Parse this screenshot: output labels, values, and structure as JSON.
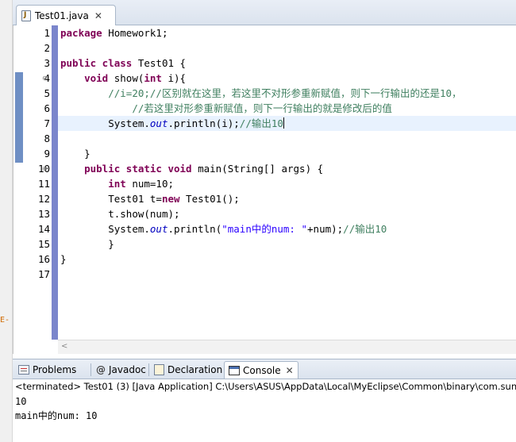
{
  "editor": {
    "tab": {
      "title": "Test01.java",
      "close": "✕",
      "icon": "java-file-icon"
    },
    "line_numbers": [
      "1",
      "2",
      "3",
      "4",
      "5",
      "6",
      "7",
      "8",
      "9",
      "10",
      "11",
      "12",
      "13",
      "14",
      "15",
      "16",
      "17"
    ],
    "lines": {
      "l1": {
        "kw": "package",
        "rest": " Homework1;"
      },
      "l3": {
        "kw": "public class",
        "rest": " Test01 {"
      },
      "l4": {
        "indent": "    ",
        "kw1": "void",
        "mid": " show(",
        "kw2": "int",
        "rest": " i){"
      },
      "l5": {
        "indent": "        ",
        "comment": "//i=20;//区别就在这里，若这里不对形参重新赋值，则下一行输出的还是10，"
      },
      "l6": {
        "indent": "            ",
        "comment": "//若这里对形参重新赋值，则下一行输出的就是修改后的值"
      },
      "l7": {
        "indent": "        ",
        "pre": "System.",
        "field": "out",
        "post": ".println(i);",
        "comment": "//输出10"
      },
      "l9": {
        "indent": "    ",
        "text": "}"
      },
      "l10": {
        "indent": "    ",
        "kw": "public static void",
        "rest": " main(String[] args) {"
      },
      "l11": {
        "indent": "        ",
        "kw": "int",
        "rest": " num=10;"
      },
      "l12": {
        "indent": "        ",
        "pre": "Test01 t=",
        "kw": "new",
        "rest": " Test01();"
      },
      "l13": {
        "indent": "        ",
        "text": "t.show(num);"
      },
      "l14": {
        "indent": "        ",
        "pre": "System.",
        "field": "out",
        "mid": ".println(",
        "string": "\"main中的num: \"",
        "post": "+num);",
        "comment": "//输出10"
      },
      "l15": {
        "indent": "        ",
        "text": "}"
      },
      "l16": {
        "text": "}"
      }
    }
  },
  "views": {
    "tabs": [
      {
        "label": "Problems",
        "icon": "problems-icon"
      },
      {
        "label": "Javadoc",
        "icon": "at-sign-icon",
        "glyph": "@"
      },
      {
        "label": "Declaration",
        "icon": "declaration-icon"
      },
      {
        "label": "Console",
        "icon": "console-icon",
        "close": "✕",
        "active": true
      }
    ]
  },
  "console": {
    "status": "<terminated> Test01 (3) [Java Application] C:\\Users\\ASUS\\AppData\\Local\\MyEclipse\\Common\\binary\\com.sun",
    "output": [
      "10",
      "main中的num: 10"
    ]
  },
  "left_edge": {
    "fragment": "E-"
  },
  "colors": {
    "keyword": "#7f0055",
    "comment": "#3f7f5f",
    "string": "#2a00ff",
    "field": "#0000c0",
    "sidebar": "#7b86cc",
    "current_line": "#e8f2fe"
  }
}
